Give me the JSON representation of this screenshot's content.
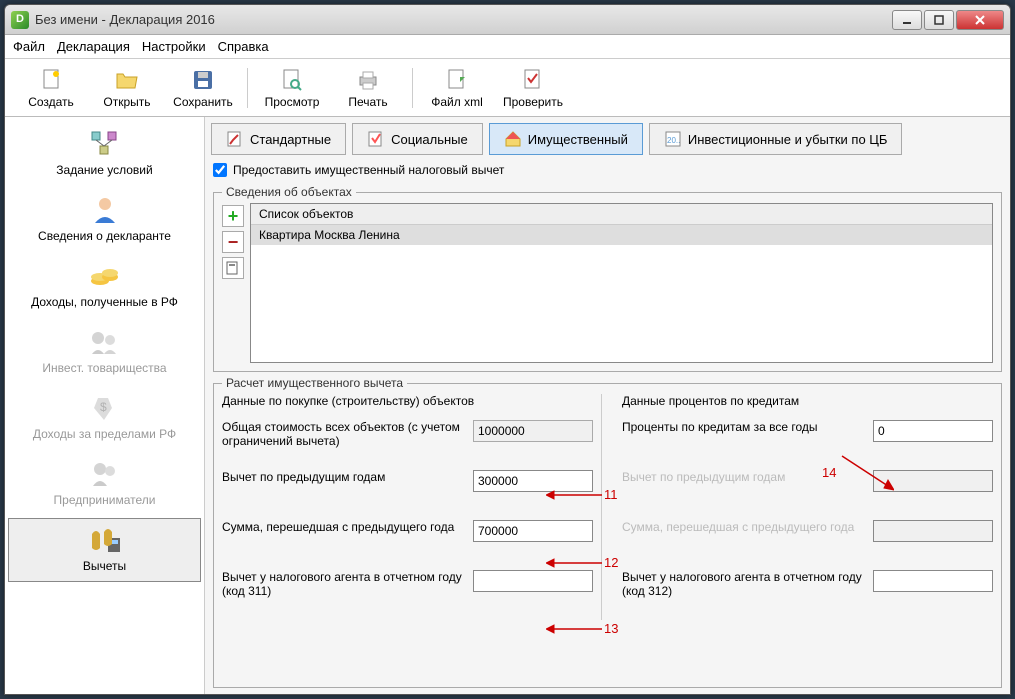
{
  "window": {
    "title": "Без имени - Декларация 2016"
  },
  "menu": {
    "file": "Файл",
    "declaration": "Декларация",
    "settings": "Настройки",
    "help": "Справка"
  },
  "toolbar": {
    "create": "Создать",
    "open": "Открыть",
    "save": "Сохранить",
    "preview": "Просмотр",
    "print": "Печать",
    "fileXml": "Файл xml",
    "check": "Проверить"
  },
  "sidebar": {
    "items": [
      {
        "label": "Задание условий"
      },
      {
        "label": "Сведения о декларанте"
      },
      {
        "label": "Доходы, полученные в РФ"
      },
      {
        "label": "Инвест. товарищества"
      },
      {
        "label": "Доходы за пределами РФ"
      },
      {
        "label": "Предприниматели"
      },
      {
        "label": "Вычеты"
      }
    ]
  },
  "tabs": {
    "standard": "Стандартные",
    "social": "Социальные",
    "property": "Имущественный",
    "invest": "Инвестиционные и убытки по ЦБ",
    "investBadge": "20.."
  },
  "checkbox": {
    "label": "Предоставить имущественный налоговый вычет"
  },
  "objects": {
    "legend": "Сведения об объектах",
    "header": "Список объектов",
    "item": "Квартира Москва  Ленина"
  },
  "calc": {
    "legend": "Расчет имущественного вычета",
    "purchase_header": "Данные по покупке (строительству) объектов",
    "credit_header": "Данные процентов по кредитам",
    "total_label": "Общая стоимость всех объектов (с учетом ограничений вычета)",
    "total_value": "1000000",
    "prev_years_label": "Вычет по предыдущим годам",
    "prev_years_value": "300000",
    "carryover_label": "Сумма, перешедшая с предыдущего года",
    "carryover_value": "700000",
    "agent311_label": "Вычет у налогового агента в отчетном году (код 311)",
    "agent311_value": "",
    "credit_total_label": "Проценты по кредитам за все годы",
    "credit_total_value": "0",
    "credit_prev_label": "Вычет по предыдущим годам",
    "credit_prev_value": "",
    "credit_carry_label": "Сумма, перешедшая с предыдущего года",
    "credit_carry_value": "",
    "agent312_label": "Вычет у налогового агента в отчетном году (код 312)",
    "agent312_value": ""
  },
  "annotations": {
    "n11": "11",
    "n12": "12",
    "n13": "13",
    "n14": "14"
  }
}
